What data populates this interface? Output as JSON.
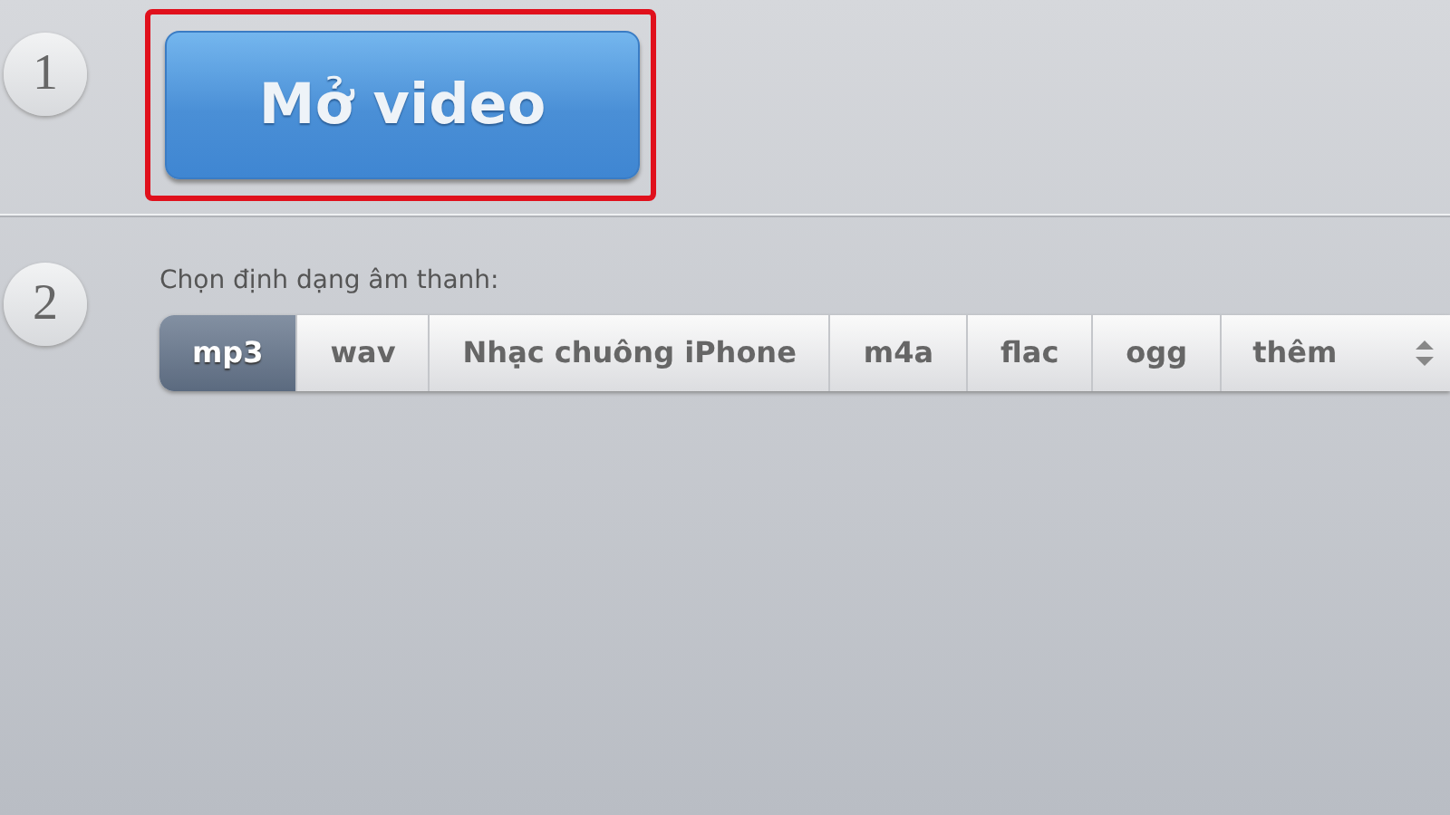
{
  "steps": [
    {
      "number": "1",
      "kind": "button",
      "button": {
        "label": "Mở video",
        "highlighted": true
      }
    },
    {
      "number": "2",
      "kind": "formats",
      "label": "Chọn định dạng âm thanh:",
      "formats": [
        {
          "label": "mp3",
          "selected": true
        },
        {
          "label": "wav",
          "selected": false
        },
        {
          "label": "Nhạc chuông iPhone",
          "selected": false
        },
        {
          "label": "m4a",
          "selected": false
        },
        {
          "label": "flac",
          "selected": false
        },
        {
          "label": "ogg",
          "selected": false
        }
      ],
      "more": {
        "label": "thêm"
      }
    }
  ]
}
